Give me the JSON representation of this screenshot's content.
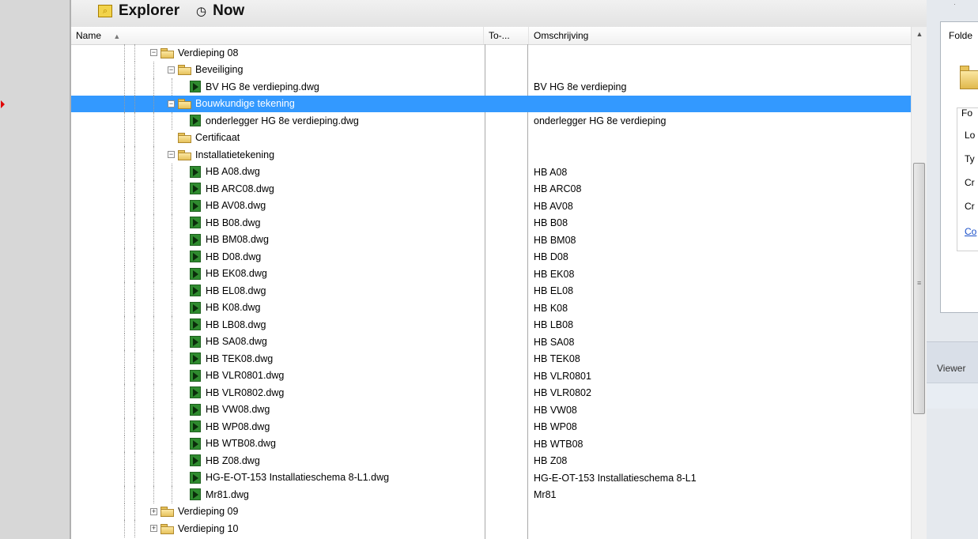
{
  "title_bar": {
    "explorer_label": "Explorer",
    "now_label": "Now",
    "explorer_icon": "magnifier-icon",
    "now_icon": "clock-icon"
  },
  "columns": {
    "name": "Name",
    "to": "To-...",
    "omschrijving": "Omschrijving"
  },
  "rows": [
    {
      "level": 0,
      "type": "folder",
      "expand": "minus",
      "name": "Verdieping 08",
      "omsch": ""
    },
    {
      "level": 1,
      "type": "folder",
      "expand": "minus",
      "name": "Beveiliging",
      "omsch": ""
    },
    {
      "level": 2,
      "type": "file",
      "name": "BV HG 8e verdieping.dwg",
      "omsch": "BV HG 8e verdieping"
    },
    {
      "level": 1,
      "type": "folder",
      "expand": "minus",
      "name": "Bouwkundige tekening",
      "omsch": "",
      "selected": true
    },
    {
      "level": 2,
      "type": "file",
      "name": "onderlegger HG 8e verdieping.dwg",
      "omsch": "onderlegger HG 8e verdieping"
    },
    {
      "level": 1,
      "type": "folder",
      "expand": "none",
      "name": "Certificaat",
      "omsch": ""
    },
    {
      "level": 1,
      "type": "folder",
      "expand": "minus",
      "name": "Installatietekening",
      "omsch": ""
    },
    {
      "level": 2,
      "type": "file",
      "name": "HB A08.dwg",
      "omsch": "HB A08"
    },
    {
      "level": 2,
      "type": "file",
      "name": "HB ARC08.dwg",
      "omsch": "HB ARC08"
    },
    {
      "level": 2,
      "type": "file",
      "name": "HB AV08.dwg",
      "omsch": "HB AV08"
    },
    {
      "level": 2,
      "type": "file",
      "name": "HB B08.dwg",
      "omsch": "HB B08"
    },
    {
      "level": 2,
      "type": "file",
      "name": "HB BM08.dwg",
      "omsch": "HB BM08"
    },
    {
      "level": 2,
      "type": "file",
      "name": "HB D08.dwg",
      "omsch": "HB D08"
    },
    {
      "level": 2,
      "type": "file",
      "name": "HB EK08.dwg",
      "omsch": "HB EK08"
    },
    {
      "level": 2,
      "type": "file",
      "name": "HB EL08.dwg",
      "omsch": "HB EL08"
    },
    {
      "level": 2,
      "type": "file",
      "name": "HB K08.dwg",
      "omsch": "HB K08"
    },
    {
      "level": 2,
      "type": "file",
      "name": "HB LB08.dwg",
      "omsch": "HB LB08"
    },
    {
      "level": 2,
      "type": "file",
      "name": "HB SA08.dwg",
      "omsch": "HB SA08"
    },
    {
      "level": 2,
      "type": "file",
      "name": "HB TEK08.dwg",
      "omsch": "HB TEK08"
    },
    {
      "level": 2,
      "type": "file",
      "name": "HB VLR0801.dwg",
      "omsch": "HB VLR0801"
    },
    {
      "level": 2,
      "type": "file",
      "name": "HB VLR0802.dwg",
      "omsch": "HB VLR0802"
    },
    {
      "level": 2,
      "type": "file",
      "name": "HB VW08.dwg",
      "omsch": "HB VW08"
    },
    {
      "level": 2,
      "type": "file",
      "name": "HB WP08.dwg",
      "omsch": "HB WP08"
    },
    {
      "level": 2,
      "type": "file",
      "name": "HB WTB08.dwg",
      "omsch": "HB WTB08"
    },
    {
      "level": 2,
      "type": "file",
      "name": "HB Z08.dwg",
      "omsch": "HB Z08"
    },
    {
      "level": 2,
      "type": "file",
      "name": "HG-E-OT-153 Installatieschema  8-L1.dwg",
      "omsch": "HG-E-OT-153 Installatieschema  8-L1"
    },
    {
      "level": 2,
      "type": "file",
      "name": "Mr81.dwg",
      "omsch": "Mr81"
    },
    {
      "level": 0,
      "type": "folder",
      "expand": "plus",
      "name": "Verdieping 09",
      "omsch": ""
    },
    {
      "level": 0,
      "type": "folder",
      "expand": "plus",
      "name": "Verdieping 10",
      "omsch": ""
    }
  ],
  "right_panel": {
    "tab_label": "Folde",
    "group_label": "Fo",
    "lines": [
      "Lo",
      "Ty",
      "Cr",
      "Cr"
    ],
    "link": "Co",
    "viewer_label": "Viewer"
  },
  "colors": {
    "selection": "#3399ff",
    "file_icon": "#2f8b2f",
    "marker": "#e00000",
    "link": "#1a4fc9"
  }
}
